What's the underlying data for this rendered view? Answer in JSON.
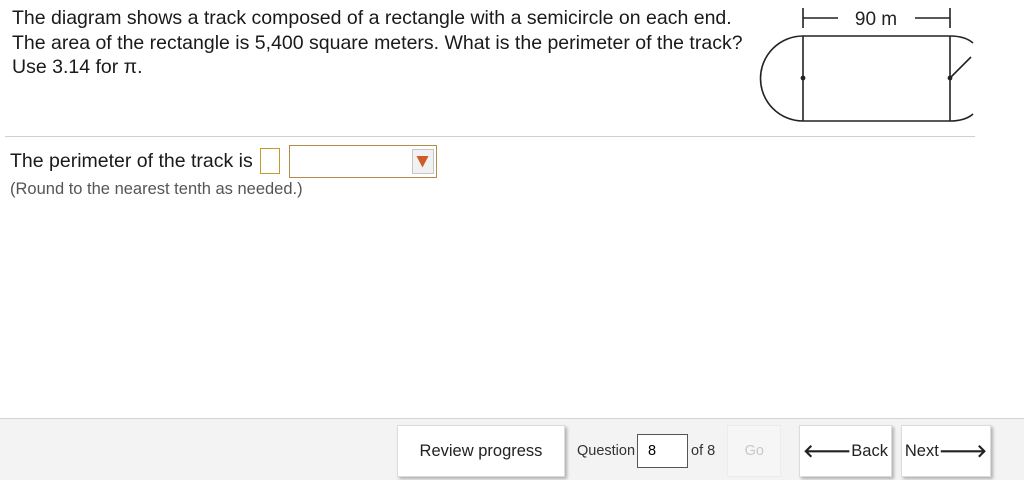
{
  "question": {
    "text": "The diagram shows a track composed of a rectangle with a semicircle on each end. The area of the rectangle is 5,400 square meters. What is the perimeter of the track? Use 3.14 for π."
  },
  "diagram": {
    "dimension_label": "90 m"
  },
  "answer": {
    "label": "The perimeter of the track is",
    "value": "",
    "unit_selected": "",
    "hint": "(Round to the nearest tenth as needed.)"
  },
  "footer": {
    "review_label": "Review progress",
    "question_label": "Question",
    "question_number": "8",
    "of_label": "of 8",
    "go_label": "Go",
    "back_label": "Back",
    "next_label": "Next"
  },
  "colors": {
    "answer_border": "#c49a2c",
    "dropdown_arrow": "#d05a28"
  }
}
